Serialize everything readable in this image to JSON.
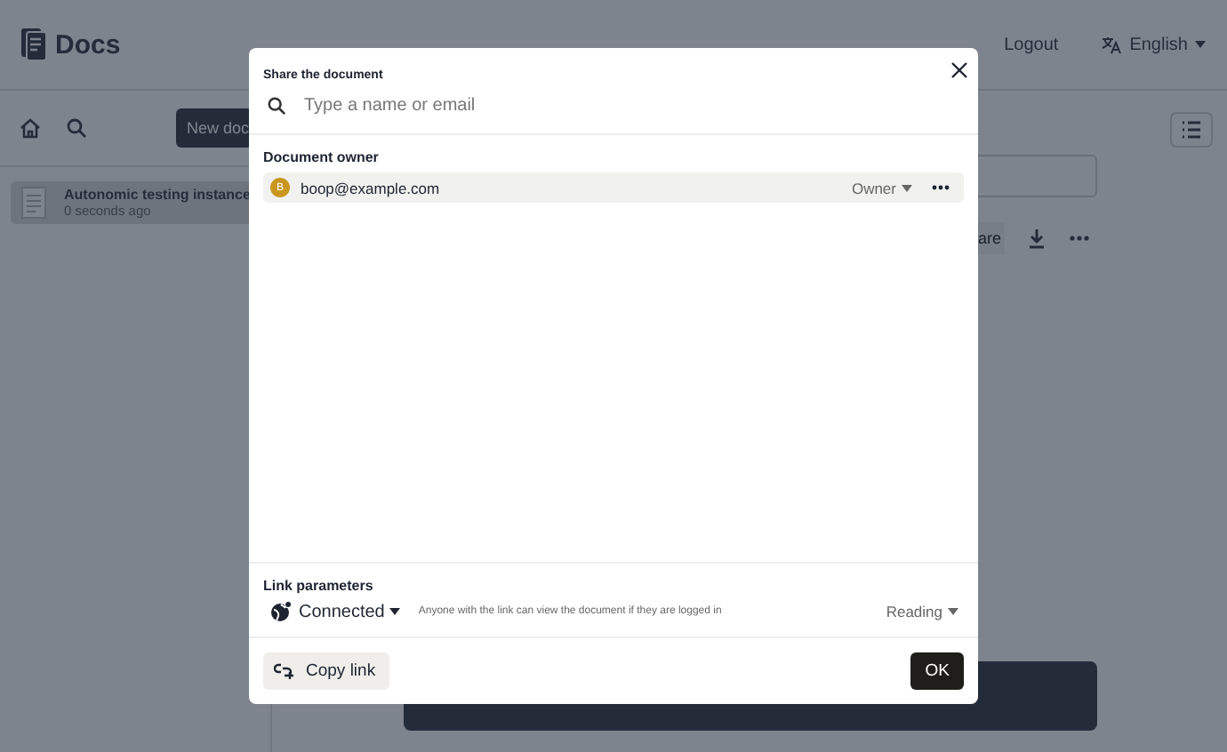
{
  "header": {
    "logo": "Docs",
    "logout": "Logout",
    "language": "English"
  },
  "sidebar": {
    "new_button": "New doc",
    "documents": [
      {
        "title": "Autonomic testing instance",
        "time": "0 seconds ago",
        "selected": true
      }
    ]
  },
  "toolbar": {
    "share_button": "are"
  },
  "dialog": {
    "title": "Share the document",
    "search": {
      "placeholder": "Type a name or email"
    },
    "owner_section": {
      "title": "Document owner",
      "members": [
        {
          "initial": "B",
          "email": "boop@example.com",
          "role": "Owner",
          "color": "#c9961e"
        }
      ]
    },
    "link_section": {
      "title": "Link parameters",
      "scope": "Connected",
      "description": "Anyone with the link can view the document if they are logged in",
      "permission": "Reading"
    },
    "copy_button": "Copy link",
    "ok_button": "OK"
  }
}
